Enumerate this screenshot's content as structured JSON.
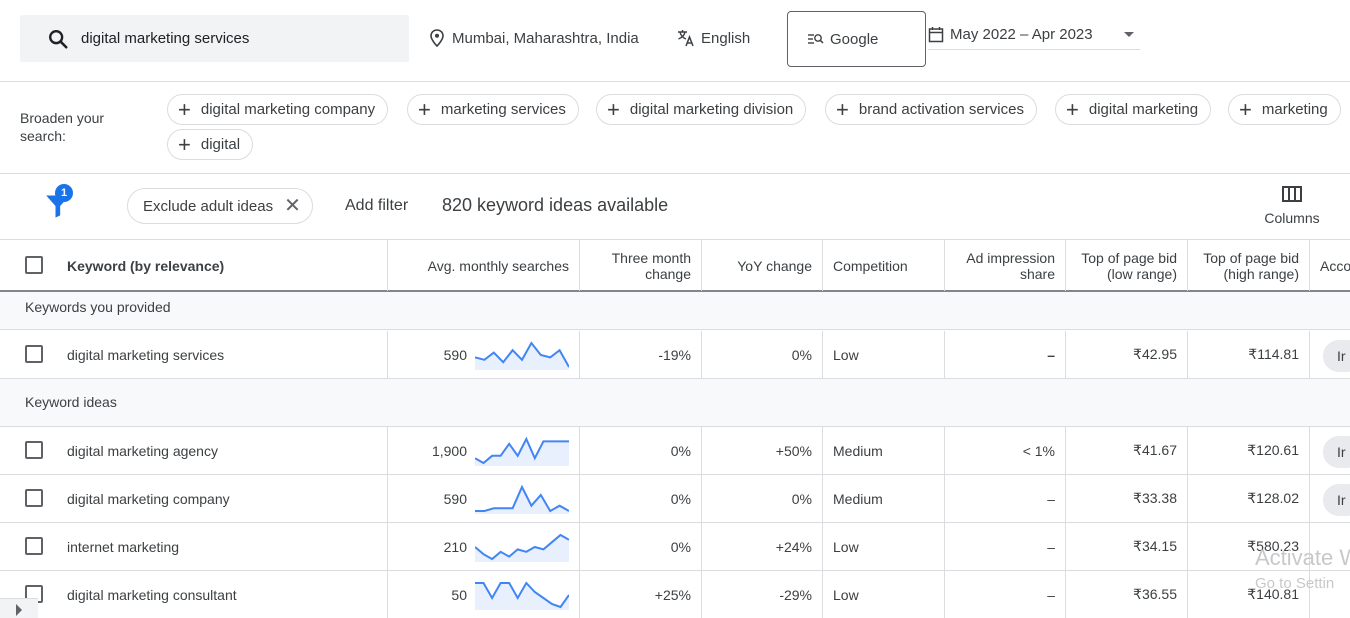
{
  "header": {
    "search_value": "digital marketing services",
    "location": "Mumbai, Maharashtra, India",
    "language": "English",
    "network": "Google",
    "date_range": "May 2022 – Apr 2023"
  },
  "broaden": {
    "label": "Broaden your search:",
    "chips": [
      "digital marketing company",
      "marketing services",
      "digital marketing division",
      "brand activation services",
      "digital marketing",
      "marketing",
      "digital"
    ]
  },
  "filters": {
    "badge_count": "1",
    "exclude_chip": "Exclude adult ideas",
    "add_filter": "Add filter",
    "ideas_count": "820 keyword ideas available",
    "columns_label": "Columns"
  },
  "table": {
    "headers": {
      "keyword": "Keyword (by relevance)",
      "avg_searches": "Avg. monthly searches",
      "three_month": "Three month change",
      "yoy": "YoY change",
      "competition": "Competition",
      "ad_share": "Ad impression share",
      "bid_low": "Top of page bid (low range)",
      "bid_high": "Top of page bid (high range)",
      "account": "Acco"
    },
    "group_provided": "Keywords you provided",
    "group_ideas": "Keyword ideas",
    "rows": [
      {
        "keyword": "digital marketing services",
        "searches": "590",
        "three_month": "-19%",
        "yoy": "0%",
        "competition": "Low",
        "ad_share": "–",
        "bid_low": "₹42.95",
        "bid_high": "₹114.81",
        "account": "Ir",
        "trend": [
          4,
          3,
          6,
          2,
          7,
          3,
          10,
          5,
          4,
          7,
          0
        ]
      },
      {
        "keyword": "digital marketing agency",
        "searches": "1,900",
        "three_month": "0%",
        "yoy": "+50%",
        "competition": "Medium",
        "ad_share": "< 1%",
        "bid_low": "₹41.67",
        "bid_high": "₹120.61",
        "account": "Ir",
        "trend": [
          2,
          0,
          3,
          3,
          8,
          3,
          10,
          2,
          9,
          9,
          9,
          9
        ]
      },
      {
        "keyword": "digital marketing company",
        "searches": "590",
        "three_month": "0%",
        "yoy": "0%",
        "competition": "Medium",
        "ad_share": "–",
        "bid_low": "₹33.38",
        "bid_high": "₹128.02",
        "account": "Ir",
        "trend": [
          1,
          1,
          2,
          2,
          2,
          10,
          3,
          7,
          1,
          3,
          1
        ]
      },
      {
        "keyword": "internet marketing",
        "searches": "210",
        "three_month": "0%",
        "yoy": "+24%",
        "competition": "Low",
        "ad_share": "–",
        "bid_low": "₹34.15",
        "bid_high": "₹580.23",
        "account": "",
        "trend": [
          5,
          2,
          0,
          3,
          1,
          4,
          3,
          5,
          4,
          7,
          10,
          8
        ]
      },
      {
        "keyword": "digital marketing consultant",
        "searches": "50",
        "three_month": "+25%",
        "yoy": "-29%",
        "competition": "Low",
        "ad_share": "–",
        "bid_low": "₹36.55",
        "bid_high": "₹140.81",
        "account": "",
        "trend": [
          9,
          9,
          4,
          9,
          9,
          4,
          9,
          6,
          4,
          2,
          1,
          5
        ]
      }
    ]
  },
  "watermark": {
    "line1": "Activate W",
    "line2": "Go to Settin"
  },
  "colors": {
    "accent": "#1a73e8",
    "spark_line": "#4285f4",
    "spark_fill": "#e8f0fe"
  }
}
